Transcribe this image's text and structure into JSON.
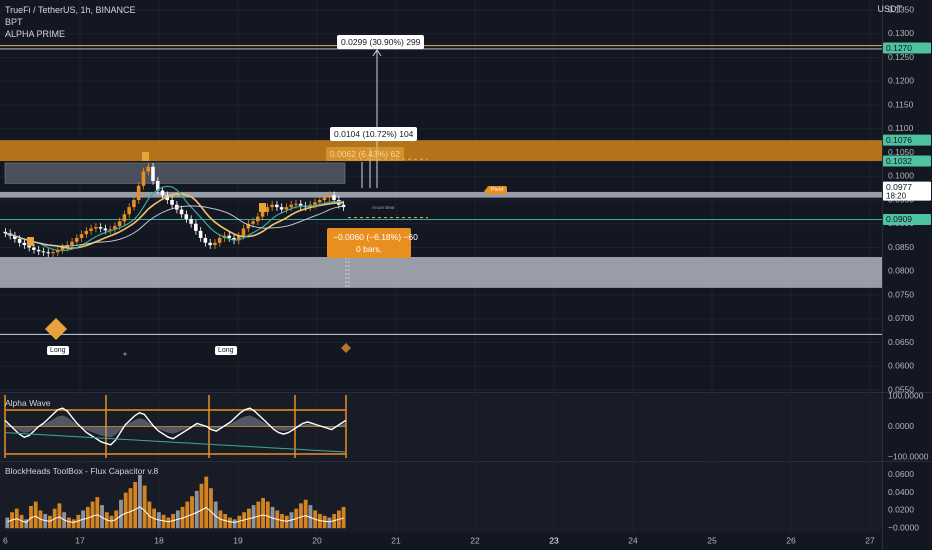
{
  "header": {
    "symbol_line": "TrueFi / TetherUS, 1h, BINANCE",
    "indicator_1": "BPT",
    "indicator_2": "ALPHA PRIME",
    "currency": "USDT"
  },
  "panes": {
    "oscillator_title": "Alpha Wave",
    "volume_title": "BlockHeads ToolBox - Flux Capacitor v.8"
  },
  "annotations": {
    "target_measure": "0.0299 (30.90%) 299",
    "mid_measure": "0.0104 (10.72%) 104",
    "faded_measure": "0.0062 (6.43%) 62",
    "drop_measure": "−0.0060 (−6.18%) −60",
    "drop_bars": "0 bars,",
    "signal_long_1": "Long",
    "signal_long_2": "Long",
    "short_tag": "Pivot",
    "mini_label": "Aroon Bear"
  },
  "colors": {
    "background": "#131722",
    "candle_up": "#e88f20",
    "candle_down": "#ffffff",
    "zone": "#c77d1a",
    "teal": "#3ea89a",
    "price_tag": "#4fc3a1",
    "grid": "#1e222d"
  },
  "chart_data": [
    {
      "type": "line",
      "pane": "price",
      "x_axis": {
        "ticks": [
          "6",
          "17",
          "18",
          "19",
          "20",
          "21",
          "22",
          "23",
          "24",
          "25",
          "26",
          "27"
        ]
      },
      "y_axis": {
        "ticks": [
          "0.1350",
          "0.1300",
          "0.1250",
          "0.1200",
          "0.1150",
          "0.1100",
          "0.1050",
          "0.1000",
          "0.0950",
          "0.0900",
          "0.0850",
          "0.0800",
          "0.0750",
          "0.0700",
          "0.0650",
          "0.0600",
          "0.0550"
        ],
        "range": [
          0.055,
          0.135
        ]
      },
      "price_tags": [
        {
          "label": "0.1270",
          "value": 0.127
        },
        {
          "label": "0.1076",
          "value": 0.1076
        },
        {
          "label": "0.1032",
          "value": 0.1032
        },
        {
          "label": "0.0977",
          "sublabel": "18:20",
          "value": 0.0977
        },
        {
          "label": "0.0909",
          "value": 0.0909
        }
      ],
      "close_series": [
        0.088,
        0.0875,
        0.0868,
        0.086,
        0.0855,
        0.085,
        0.0845,
        0.0842,
        0.084,
        0.0838,
        0.084,
        0.0845,
        0.085,
        0.0855,
        0.0862,
        0.087,
        0.0878,
        0.0885,
        0.089,
        0.0893,
        0.089,
        0.0886,
        0.0888,
        0.0895,
        0.0905,
        0.092,
        0.0935,
        0.095,
        0.098,
        0.101,
        0.102,
        0.099,
        0.097,
        0.096,
        0.095,
        0.094,
        0.093,
        0.092,
        0.091,
        0.09,
        0.0885,
        0.087,
        0.086,
        0.0855,
        0.086,
        0.087,
        0.0875,
        0.087,
        0.0865,
        0.0875,
        0.089,
        0.09,
        0.0905,
        0.0915,
        0.0925,
        0.0935,
        0.094,
        0.0935,
        0.093,
        0.0935,
        0.094,
        0.0942,
        0.0938,
        0.0935,
        0.094,
        0.0945,
        0.095,
        0.0955,
        0.096,
        0.095,
        0.094,
        0.0935
      ]
    },
    {
      "type": "line",
      "pane": "oscillator",
      "y_axis": {
        "ticks": [
          "100.0000",
          "0.0000",
          "−100.0000"
        ],
        "range": [
          -100,
          100
        ]
      },
      "values": [
        20,
        5,
        -10,
        -25,
        -35,
        -30,
        -15,
        0,
        10,
        25,
        40,
        55,
        60,
        50,
        30,
        10,
        -5,
        -20,
        -30,
        -40,
        -50,
        -55,
        -60,
        -45,
        -20,
        5,
        20,
        35,
        45,
        40,
        20,
        0,
        -15,
        -25,
        -35,
        -40,
        -30,
        -20,
        -10,
        0,
        10,
        5,
        0,
        -10,
        -15,
        -5,
        5,
        15,
        30,
        45,
        55,
        60,
        50,
        35,
        20,
        5,
        -10,
        -20,
        -25,
        -20,
        -10,
        0,
        10,
        15,
        10,
        5,
        0,
        -5,
        -10,
        0,
        10,
        20
      ]
    },
    {
      "type": "bar",
      "pane": "volume",
      "y_axis": {
        "ticks": [
          "0.0600",
          "0.0400",
          "0.0200",
          "−0.0000"
        ],
        "range": [
          -0.002,
          0.07
        ]
      },
      "values": [
        0.012,
        0.018,
        0.022,
        0.015,
        0.01,
        0.025,
        0.03,
        0.02,
        0.016,
        0.014,
        0.022,
        0.028,
        0.018,
        0.012,
        0.01,
        0.015,
        0.02,
        0.024,
        0.03,
        0.035,
        0.026,
        0.018,
        0.014,
        0.02,
        0.032,
        0.04,
        0.045,
        0.052,
        0.06,
        0.048,
        0.03,
        0.022,
        0.018,
        0.015,
        0.012,
        0.016,
        0.02,
        0.024,
        0.03,
        0.036,
        0.042,
        0.05,
        0.058,
        0.045,
        0.03,
        0.02,
        0.016,
        0.012,
        0.01,
        0.014,
        0.018,
        0.022,
        0.026,
        0.03,
        0.034,
        0.03,
        0.024,
        0.02,
        0.016,
        0.014,
        0.018,
        0.022,
        0.028,
        0.032,
        0.026,
        0.02,
        0.016,
        0.014,
        0.012,
        0.016,
        0.02,
        0.024
      ]
    }
  ]
}
